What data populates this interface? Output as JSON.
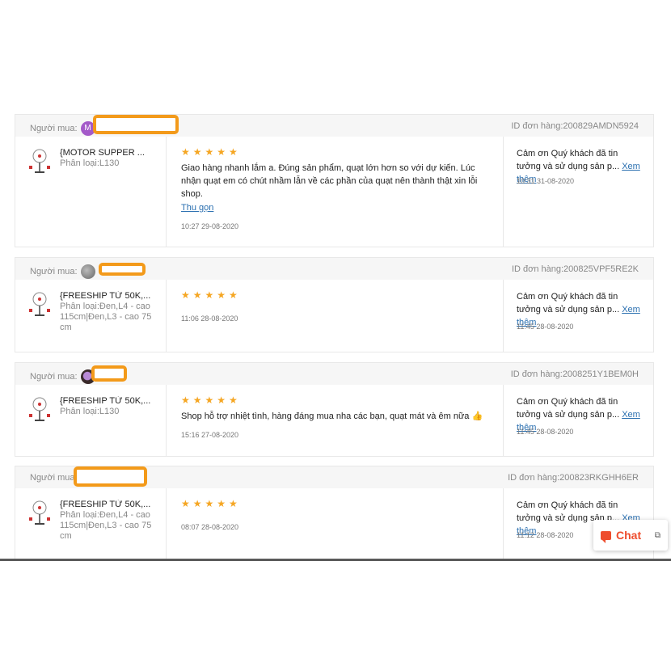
{
  "buyer_label": "Người mua:",
  "order_label": "ID đơn hàng:",
  "reviews": [
    {
      "avatar_letter": "M",
      "order_id": "200829AMDN5924",
      "product_name": "{MOTOR SUPPER ...",
      "variation": "Phân loại:L130",
      "rating": "★★★★★",
      "text": "Giao hàng nhanh lắm a. Đúng sản phẩm, quạt lớn hơn so với dự kiến. Lúc nhận quạt em có chút nhầm lẫn về các phần của quạt nên thành thật xin lỗi shop.",
      "toggle": "Thu gọn",
      "date": "10:27 29-08-2020",
      "reply_text": "Cảm ơn Quý khách đã tin tưởng và sử dụng sản p...",
      "reply_more": "Xem thêm",
      "reply_date": "10:31 31-08-2020"
    },
    {
      "avatar_letter": "",
      "order_id": "200825VPF5RE2K",
      "product_name": "{FREESHIP TỪ 50K,...",
      "variation": "Phân loại:Đen,L4 - cao 115cm|Đen,L3 - cao 75 cm",
      "rating": "★★★★★",
      "text": "",
      "toggle": "",
      "date": "11:06 28-08-2020",
      "reply_text": "Cảm ơn Quý khách đã tin tưởng và sử dụng sản p...",
      "reply_more": "Xem thêm",
      "reply_date": "11:45 28-08-2020"
    },
    {
      "avatar_letter": "",
      "order_id": "2008251Y1BEM0H",
      "product_name": "{FREESHIP TỪ 50K,...",
      "variation": "Phân loại:L130",
      "rating": "★★★★★",
      "text": "Shop hỗ trợ nhiệt tình, hàng đáng mua nha các bạn, quạt mát và êm nữa 👍",
      "toggle": "",
      "date": "15:16 27-08-2020",
      "reply_text": "Cảm ơn Quý khách đã tin tưởng và sử dụng sản p...",
      "reply_more": "Xem thêm",
      "reply_date": "11:45 28-08-2020"
    },
    {
      "avatar_letter": "",
      "order_id": "200823RKGHH6ER",
      "product_name": "{FREESHIP TỪ 50K,...",
      "variation": "Phân loại:Đen,L4 - cao 115cm|Đen,L3 - cao 75 cm",
      "rating": "★★★★★",
      "text": "",
      "toggle": "",
      "date": "08:07 28-08-2020",
      "reply_text": "Cảm ơn Quý khách đã tin tưởng và sử dụng sản p...",
      "reply_more": "Xem thêm",
      "reply_date": "11:12 28-08-2020"
    }
  ],
  "chat": {
    "label": "Chat",
    "icon": "chat-bubble-icon",
    "expand_icon": "expand-icon"
  },
  "colors": {
    "star": "#f5a623",
    "redaction": "#f39a1a",
    "link": "#2a6fb0",
    "chat_accent": "#ee4d2d"
  }
}
